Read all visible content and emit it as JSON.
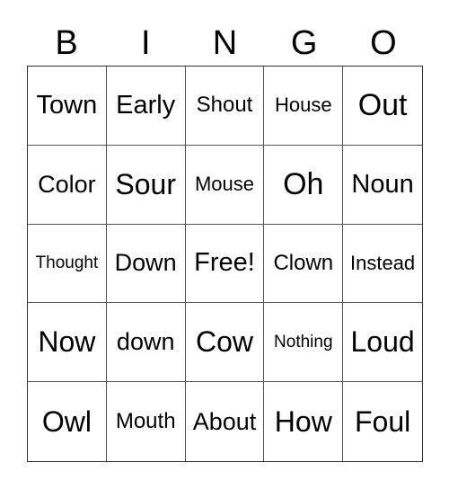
{
  "header": [
    "B",
    "I",
    "N",
    "G",
    "O"
  ],
  "cells": [
    "Town",
    "Early",
    "Shout",
    "House",
    "Out",
    "Color",
    "Sour",
    "Mouse",
    "Oh",
    "Noun",
    "Thought",
    "Down",
    "Free!",
    "Clown",
    "Instead",
    "Now",
    "down",
    "Cow",
    "Nothing",
    "Loud",
    "Owl",
    "Mouth",
    "About",
    "How",
    "Foul"
  ]
}
